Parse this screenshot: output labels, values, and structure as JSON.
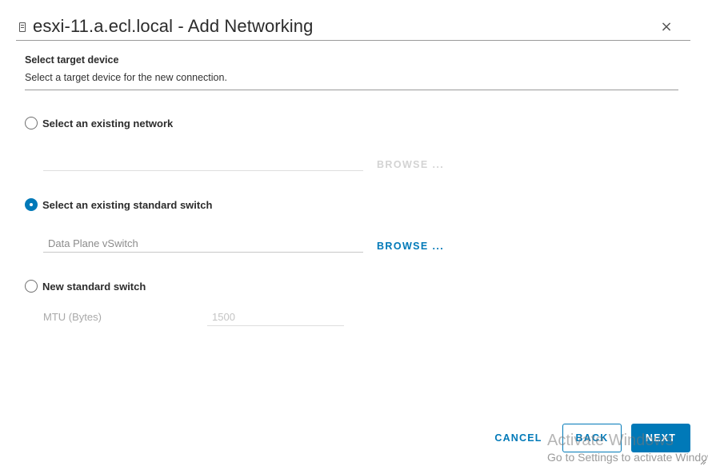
{
  "dialog": {
    "title": "esxi-11.a.ecl.local - Add Networking",
    "host_icon": "host-icon",
    "close_glyph": "×"
  },
  "step": {
    "title": "Select target device",
    "description": "Select a target device for the new connection."
  },
  "options": {
    "existing_network": {
      "label": "Select an existing network",
      "checked": false,
      "value": "",
      "browse_label": "BROWSE ...",
      "browse_enabled": false
    },
    "existing_switch": {
      "label": "Select an existing standard switch",
      "checked": true,
      "value": "Data Plane vSwitch",
      "browse_label": "BROWSE ...",
      "browse_enabled": true
    },
    "new_switch": {
      "label": "New standard switch",
      "checked": false,
      "mtu_label": "MTU (Bytes)",
      "mtu_value": "1500"
    }
  },
  "footer": {
    "cancel_label": "CANCEL",
    "back_label": "BACK",
    "next_label": "NEXT"
  },
  "watermark": {
    "title": "Activate Windows",
    "subtitle": "Go to Settings to activate Windows."
  },
  "colors": {
    "accent": "#0079b8",
    "divider": "#9a9a9a",
    "disabled_text": "#d3d3d3"
  }
}
